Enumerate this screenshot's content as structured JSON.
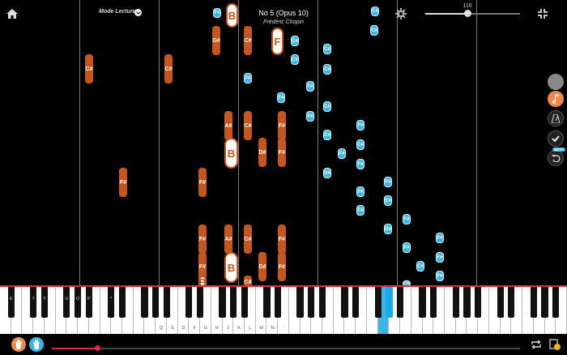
{
  "header": {
    "mode_label": "Mode Lecture",
    "title": "No 5 (Opus 10)",
    "composer": "Frédéric Chopin"
  },
  "tempo": {
    "value": "116",
    "fraction": 0.45
  },
  "progress": {
    "fraction": 0.098
  },
  "colors": {
    "left_hand": "#c5561d",
    "right_hand": "#38b6e6",
    "accent": "#e02b3a"
  },
  "icons": {
    "home": "home-icon",
    "settings": "gear-icon",
    "fullscreen_exit": "compress-icon",
    "side": [
      "circle-icon",
      "music-note-icon",
      "metronome-icon",
      "check-icon",
      "undo-icon"
    ],
    "left_hand": "left-hand-icon",
    "right_hand": "right-hand-icon",
    "loop": "loop-icon",
    "score": "score-icon"
  },
  "side_badge": "BETA",
  "keyboard": {
    "black_labels": [
      "Z",
      "E",
      "T",
      "Y",
      "U",
      "O",
      "P",
      "*"
    ],
    "white_labels": [
      "Q",
      "S",
      "D",
      "F",
      "G",
      "H",
      "J",
      "K",
      "L",
      "M",
      "%",
      "`"
    ]
  },
  "notes": {
    "left": [
      {
        "n": "C#",
        "k": 1
      },
      {
        "n": "C#",
        "k": 1
      },
      {
        "n": "G#",
        "k": 1
      },
      {
        "n": "C#",
        "k": 1
      },
      {
        "n": "B",
        "k": 2
      },
      {
        "n": "F#",
        "k": 1
      },
      {
        "n": "F#",
        "k": 1
      },
      {
        "n": "A#",
        "k": 1
      },
      {
        "n": "C#",
        "k": 1
      },
      {
        "n": "F#",
        "k": 1
      },
      {
        "n": "B",
        "k": 2
      },
      {
        "n": "D#",
        "k": 1
      },
      {
        "n": "F#",
        "k": 1
      },
      {
        "n": "F",
        "k": 2
      },
      {
        "n": "F#",
        "k": 1
      },
      {
        "n": "A#",
        "k": 1
      },
      {
        "n": "C#",
        "k": 1
      },
      {
        "n": "F#",
        "k": 1
      },
      {
        "n": "F#",
        "k": 1
      },
      {
        "n": "B",
        "k": 2
      },
      {
        "n": "D#",
        "k": 1
      },
      {
        "n": "F#",
        "k": 1
      },
      {
        "n": "C#",
        "k": 1
      },
      {
        "n": "B",
        "k": 2
      }
    ],
    "right": [
      "C#",
      "C#",
      "C#",
      "C#",
      "C#",
      "F#",
      "F#",
      "F#",
      "C#",
      "F#",
      "F#",
      "C#",
      "C#",
      "F#",
      "F#",
      "D#",
      "F#",
      "F#",
      "C#",
      "F#",
      "F#",
      "D#",
      "F#",
      "F#",
      "F#",
      "C#",
      "F#",
      "C#",
      "C#",
      "F#"
    ]
  }
}
